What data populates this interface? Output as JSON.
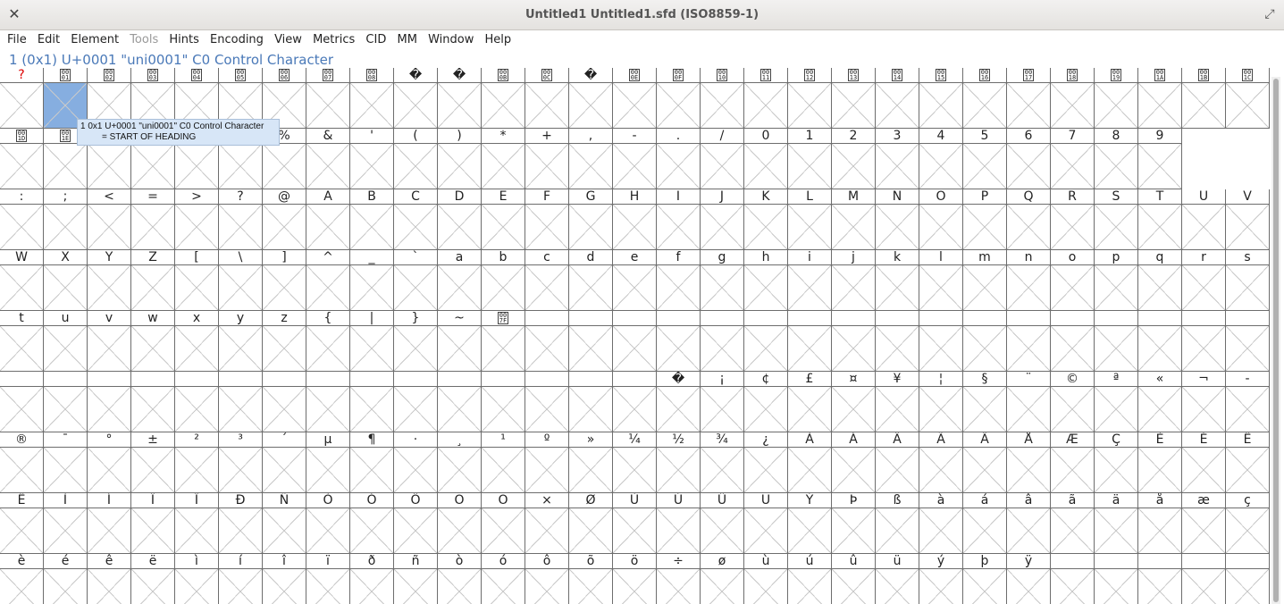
{
  "window": {
    "title": "Untitled1  Untitled1.sfd (ISO8859-1)",
    "close_glyph": "✕",
    "maximize_glyph": "⤢"
  },
  "menu": [
    {
      "label": "File",
      "enabled": true
    },
    {
      "label": "Edit",
      "enabled": true
    },
    {
      "label": "Element",
      "enabled": true
    },
    {
      "label": "Tools",
      "enabled": false
    },
    {
      "label": "Hints",
      "enabled": true
    },
    {
      "label": "Encoding",
      "enabled": true
    },
    {
      "label": "View",
      "enabled": true
    },
    {
      "label": "Metrics",
      "enabled": true
    },
    {
      "label": "CID",
      "enabled": true
    },
    {
      "label": "MM",
      "enabled": true
    },
    {
      "label": "Window",
      "enabled": true
    },
    {
      "label": "Help",
      "enabled": true
    }
  ],
  "info_line": "1 (0x1) U+0001 \"uni0001\" C0 Control Character",
  "tooltip": {
    "line1": "1 0x1 U+0001 \"uni0001\" C0 Control Character",
    "line2": "= START OF HEADING"
  },
  "grid": {
    "columns": 29,
    "selected_index": 1,
    "rows": [
      [
        "?",
        "ctrl:01",
        "ctrl:02",
        "ctrl:03",
        "ctrl:04",
        "ctrl:05",
        "ctrl:06",
        "ctrl:07",
        "ctrl:08",
        "�",
        "�",
        "ctrl:0B",
        "ctrl:0C",
        "�",
        "ctrl:0E",
        "ctrl:0F",
        "ctrl:10",
        "ctrl:11",
        "ctrl:12",
        "ctrl:13",
        "ctrl:14",
        "ctrl:15",
        "ctrl:16",
        "ctrl:17",
        "ctrl:18",
        "ctrl:19",
        "ctrl:1A",
        "ctrl:1B",
        "ctrl:1C"
      ],
      [
        "ctrl:1D",
        "ctrl:1E",
        "",
        "",
        "#",
        "$",
        "%",
        "&",
        "'",
        "(",
        ")",
        "*",
        "+",
        ",",
        "-",
        ".",
        "/",
        "0",
        "1",
        "2",
        "3",
        "4",
        "5",
        "6",
        "7",
        "8",
        "9"
      ],
      [
        ":",
        ";",
        "<",
        "=",
        ">",
        "?",
        "@",
        "A",
        "B",
        "C",
        "D",
        "E",
        "F",
        "G",
        "H",
        "I",
        "J",
        "K",
        "L",
        "M",
        "N",
        "O",
        "P",
        "Q",
        "R",
        "S",
        "T",
        "U",
        "V"
      ],
      [
        "W",
        "X",
        "Y",
        "Z",
        "[",
        "\\",
        "]",
        "^",
        "_",
        "`",
        "a",
        "b",
        "c",
        "d",
        "e",
        "f",
        "g",
        "h",
        "i",
        "j",
        "k",
        "l",
        "m",
        "n",
        "o",
        "p",
        "q",
        "r",
        "s"
      ],
      [
        "t",
        "u",
        "v",
        "w",
        "x",
        "y",
        "z",
        "{",
        "|",
        "}",
        "~",
        "ctrl:7F",
        "",
        "",
        "",
        "",
        "",
        "",
        "",
        "",
        "",
        "",
        "",
        "",
        "",
        "",
        "",
        "",
        ""
      ],
      [
        "",
        "",
        "",
        "",
        "",
        "",
        "",
        "",
        "",
        "",
        "",
        "",
        "",
        "",
        "",
        "�",
        "¡",
        "¢",
        "£",
        "¤",
        "¥",
        "¦",
        "§",
        "¨",
        "©",
        "ª",
        "«",
        "¬",
        "-"
      ],
      [
        "®",
        "¯",
        "°",
        "±",
        "²",
        "³",
        "´",
        "µ",
        "¶",
        "·",
        "¸",
        "¹",
        "º",
        "»",
        "¼",
        "½",
        "¾",
        "¿",
        "À",
        "Á",
        "Â",
        "Ã",
        "Ä",
        "Å",
        "Æ",
        "Ç",
        "È",
        "É",
        "Ê"
      ],
      [
        "Ë",
        "Ì",
        "Í",
        "Î",
        "Ï",
        "Ð",
        "Ñ",
        "Ò",
        "Ó",
        "Ô",
        "Õ",
        "Ö",
        "×",
        "Ø",
        "Ù",
        "Ú",
        "Û",
        "Ü",
        "Ý",
        "Þ",
        "ß",
        "à",
        "á",
        "â",
        "ã",
        "ä",
        "å",
        "æ",
        "ç"
      ],
      [
        "è",
        "é",
        "ê",
        "ë",
        "ì",
        "í",
        "î",
        "ï",
        "ð",
        "ñ",
        "ò",
        "ó",
        "ô",
        "õ",
        "ö",
        "÷",
        "ø",
        "ù",
        "ú",
        "û",
        "ü",
        "ý",
        "þ",
        "ÿ",
        "",
        "",
        "",
        "",
        ""
      ]
    ]
  }
}
